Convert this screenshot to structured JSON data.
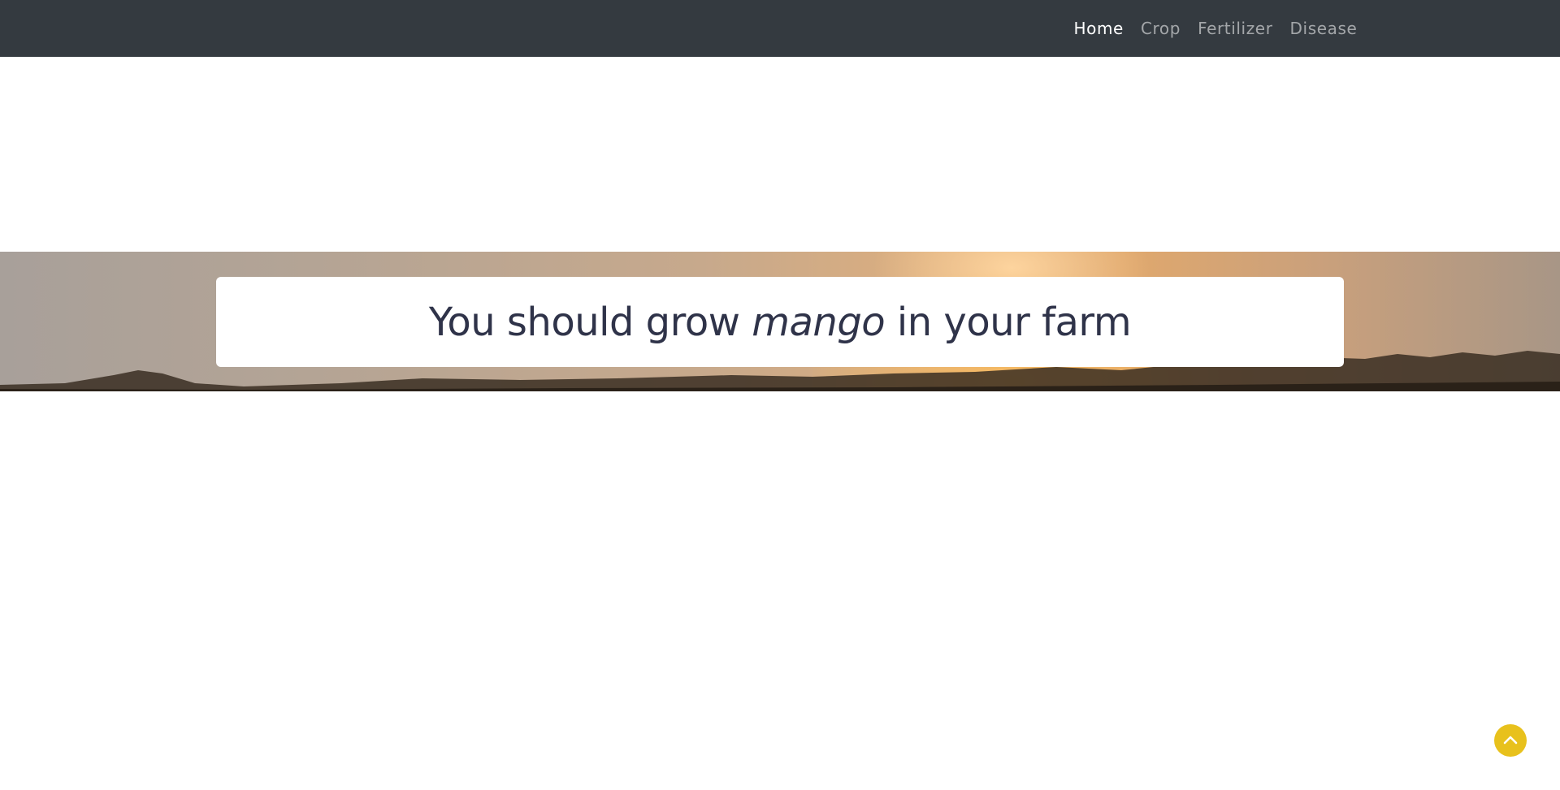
{
  "nav": {
    "items": [
      {
        "label": "Home",
        "active": true
      },
      {
        "label": "Crop",
        "active": false
      },
      {
        "label": "Fertilizer",
        "active": false
      },
      {
        "label": "Disease",
        "active": false
      }
    ]
  },
  "result": {
    "prefix": "You should grow ",
    "crop": "mango",
    "suffix": " in your farm"
  },
  "back_to_top": {
    "icon": "chevron-up-icon"
  },
  "colors": {
    "navbar_bg": "#343a40",
    "text_dark": "#2f3349",
    "accent_yellow": "#e8c11c"
  }
}
